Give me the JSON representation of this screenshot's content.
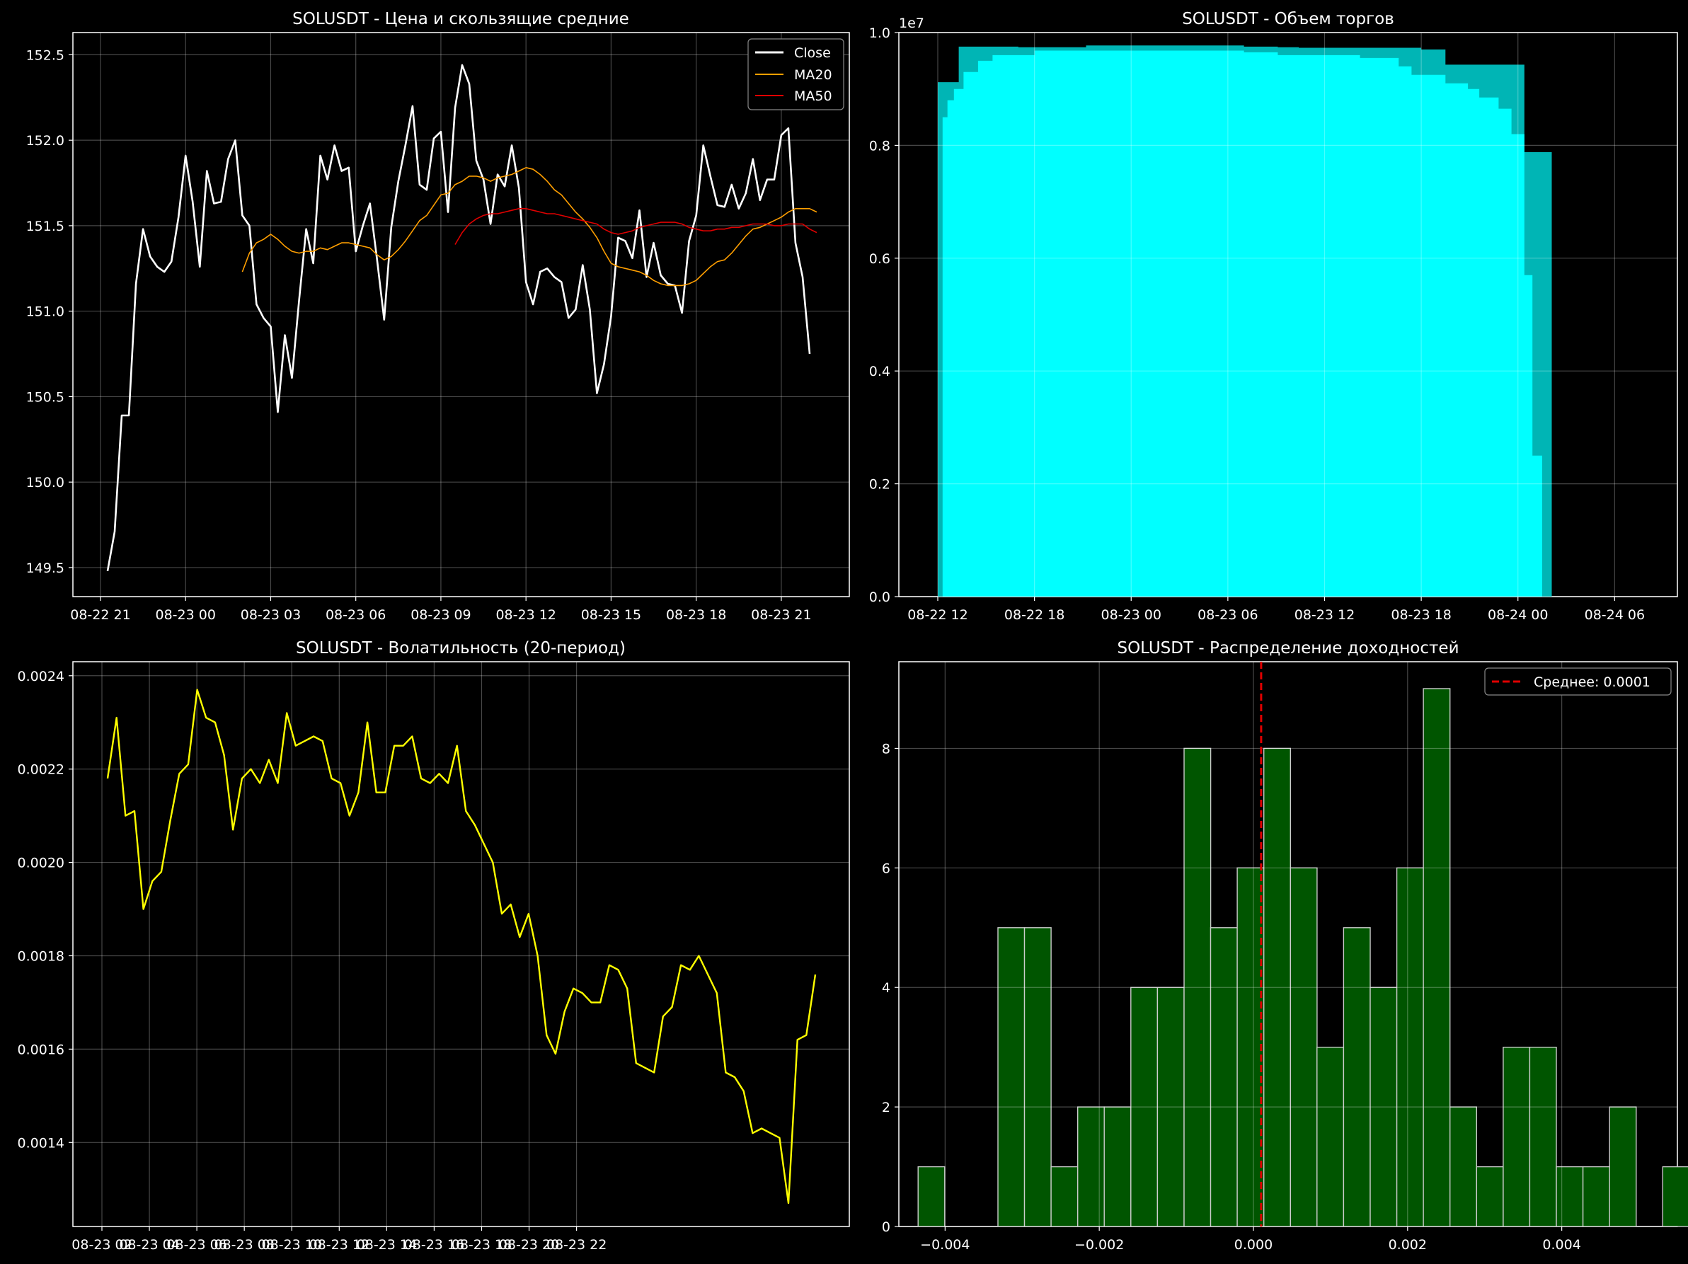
{
  "chart_data": [
    {
      "type": "line",
      "title": "SOLUSDT - Цена и скользящие средние",
      "x_tick_labels": [
        "08-22 21",
        "08-23 00",
        "08-23 03",
        "08-23 06",
        "08-23 09",
        "08-23 12",
        "08-23 15",
        "08-23 18",
        "08-23 21"
      ],
      "y_tick_labels": [
        "149.5",
        "150.0",
        "150.5",
        "151.0",
        "151.5",
        "152.0",
        "152.5"
      ],
      "ylim": [
        149.33,
        152.63
      ],
      "grid": true,
      "legend_position": "top-right",
      "series": [
        {
          "name": "Close",
          "color": "#ffffff",
          "start_index": 0,
          "values": [
            149.48,
            149.71,
            150.39,
            150.39,
            151.16,
            151.48,
            151.32,
            151.26,
            151.23,
            151.29,
            151.55,
            151.91,
            151.64,
            151.26,
            151.82,
            151.63,
            151.64,
            151.89,
            152.0,
            151.56,
            151.5,
            151.04,
            150.96,
            150.91,
            150.41,
            150.86,
            150.61,
            151.06,
            151.48,
            151.28,
            151.91,
            151.77,
            151.97,
            151.82,
            151.84,
            151.35,
            151.5,
            151.63,
            151.3,
            150.95,
            151.49,
            151.76,
            151.97,
            152.2,
            151.74,
            151.71,
            152.01,
            152.05,
            151.58,
            152.19,
            152.44,
            152.33,
            151.88,
            151.77,
            151.51,
            151.8,
            151.73,
            151.97,
            151.72,
            151.17,
            151.04,
            151.23,
            151.25,
            151.2,
            151.17,
            150.96,
            151.01,
            151.27,
            151.01,
            150.52,
            150.69,
            150.97,
            151.43,
            151.41,
            151.31,
            151.59,
            151.2,
            151.4,
            151.21,
            151.16,
            151.15,
            150.99,
            151.41,
            151.56,
            151.97,
            151.79,
            151.62,
            151.61,
            151.74,
            151.6,
            151.69,
            151.89,
            151.65,
            151.77,
            151.77,
            152.03,
            152.07,
            151.4,
            151.2,
            150.75
          ]
        },
        {
          "name": "MA20",
          "color": "#ff9f00",
          "start_index": 19,
          "values": [
            151.23,
            151.34,
            151.4,
            151.42,
            151.45,
            151.42,
            151.38,
            151.35,
            151.34,
            151.35,
            151.35,
            151.37,
            151.36,
            151.38,
            151.4,
            151.4,
            151.39,
            151.38,
            151.37,
            151.33,
            151.3,
            151.32,
            151.36,
            151.41,
            151.47,
            151.53,
            151.56,
            151.62,
            151.68,
            151.69,
            151.74,
            151.76,
            151.79,
            151.79,
            151.78,
            151.76,
            151.78,
            151.79,
            151.8,
            151.82,
            151.84,
            151.83,
            151.8,
            151.76,
            151.71,
            151.68,
            151.63,
            151.58,
            151.54,
            151.49,
            151.43,
            151.35,
            151.28,
            151.26,
            151.25,
            151.24,
            151.23,
            151.21,
            151.18,
            151.16,
            151.15,
            151.15,
            151.15,
            151.16,
            151.18,
            151.22,
            151.26,
            151.29,
            151.3,
            151.34,
            151.39,
            151.44,
            151.48,
            151.49,
            151.51,
            151.53,
            151.55,
            151.58,
            151.6,
            151.6,
            151.6,
            151.58
          ]
        },
        {
          "name": "MA50",
          "color": "#e00000",
          "start_index": 49,
          "values": [
            151.39,
            151.46,
            151.51,
            151.54,
            151.56,
            151.57,
            151.57,
            151.58,
            151.59,
            151.6,
            151.6,
            151.59,
            151.58,
            151.57,
            151.57,
            151.56,
            151.55,
            151.54,
            151.53,
            151.52,
            151.51,
            151.48,
            151.46,
            151.45,
            151.46,
            151.47,
            151.49,
            151.5,
            151.51,
            151.52,
            151.52,
            151.52,
            151.51,
            151.49,
            151.48,
            151.47,
            151.47,
            151.48,
            151.48,
            151.49,
            151.49,
            151.5,
            151.51,
            151.51,
            151.51,
            151.5,
            151.5,
            151.51,
            151.51,
            151.51,
            151.48,
            151.46
          ]
        }
      ]
    },
    {
      "type": "area",
      "title": "SOLUSDT - Объем торгов",
      "offset_label": "1e7",
      "x_tick_labels": [
        "08-22 12",
        "08-22 18",
        "08-23 00",
        "08-23 06",
        "08-23 12",
        "08-23 18",
        "08-24 00",
        "08-24 06"
      ],
      "y_tick_labels": [
        "0.0",
        "0.2",
        "0.4",
        "0.6",
        "0.8",
        "1.0"
      ],
      "ylim": [
        0,
        1.0
      ],
      "grid": true,
      "color": "#00ffff",
      "outer_envelope": [
        [
          0.0,
          0.912
        ],
        [
          1.3,
          0.975
        ],
        [
          5.0,
          0.974
        ],
        [
          9.2,
          0.977
        ],
        [
          19.0,
          0.975
        ],
        [
          21.1,
          0.974
        ],
        [
          22.4,
          0.973
        ],
        [
          30.0,
          0.97
        ],
        [
          31.5,
          0.943
        ],
        [
          34.8,
          0.943
        ],
        [
          36.4,
          0.788
        ],
        [
          37.4,
          0.788
        ],
        [
          38.1,
          0.136
        ]
      ],
      "inner_steps": [
        [
          0.1,
          0.0
        ],
        [
          0.3,
          0.85
        ],
        [
          0.6,
          0.88
        ],
        [
          1.0,
          0.9
        ],
        [
          1.6,
          0.93
        ],
        [
          2.5,
          0.95
        ],
        [
          3.4,
          0.96
        ],
        [
          6.0,
          0.968
        ],
        [
          19.0,
          0.965
        ],
        [
          21.1,
          0.96
        ],
        [
          26.2,
          0.955
        ],
        [
          28.6,
          0.94
        ],
        [
          29.4,
          0.925
        ],
        [
          31.5,
          0.91
        ],
        [
          32.9,
          0.9
        ],
        [
          33.6,
          0.885
        ],
        [
          34.8,
          0.865
        ],
        [
          35.6,
          0.82
        ],
        [
          36.4,
          0.57
        ],
        [
          36.9,
          0.25
        ],
        [
          37.5,
          0.0
        ]
      ]
    },
    {
      "type": "line",
      "title": "SOLUSDT - Волатильность (20-период)",
      "x_tick_labels": [
        "08-23 02",
        "08-23 04",
        "08-23 06",
        "08-23 08",
        "08-23 10",
        "08-23 12",
        "08-23 14",
        "08-23 16",
        "08-23 18",
        "08-23 20",
        "08-23 22"
      ],
      "y_tick_labels": [
        "0.0014",
        "0.0016",
        "0.0018",
        "0.0020",
        "0.0022",
        "0.0024"
      ],
      "ylim": [
        0.00122,
        0.00243
      ],
      "grid": true,
      "series": [
        {
          "name": "",
          "color": "#ffff00",
          "values": [
            0.00218,
            0.00231,
            0.0021,
            0.00211,
            0.0019,
            0.00196,
            0.00198,
            0.00209,
            0.00219,
            0.00221,
            0.00237,
            0.00231,
            0.0023,
            0.00223,
            0.00207,
            0.00218,
            0.0022,
            0.00217,
            0.00222,
            0.00217,
            0.00232,
            0.00225,
            0.00226,
            0.00227,
            0.00226,
            0.00218,
            0.00217,
            0.0021,
            0.00215,
            0.0023,
            0.00215,
            0.00215,
            0.00225,
            0.00225,
            0.00227,
            0.00218,
            0.00217,
            0.00219,
            0.00217,
            0.00225,
            0.00211,
            0.00208,
            0.00204,
            0.002,
            0.00189,
            0.00191,
            0.00184,
            0.00189,
            0.0018,
            0.00163,
            0.00159,
            0.00168,
            0.00173,
            0.00172,
            0.0017,
            0.0017,
            0.00178,
            0.00177,
            0.00173,
            0.00157,
            0.00156,
            0.00155,
            0.00167,
            0.00169,
            0.00178,
            0.00177,
            0.0018,
            0.00176,
            0.00172,
            0.00155,
            0.00154,
            0.00151,
            0.00142,
            0.00143,
            0.00142,
            0.00141,
            0.00127,
            0.00162,
            0.00163,
            0.00176
          ]
        }
      ]
    },
    {
      "type": "bar",
      "title": "SOLUSDT - Распределение доходностей",
      "x_tick_labels": [
        "−0.004",
        "−0.002",
        "0.000",
        "0.002",
        "0.004"
      ],
      "y_tick_labels": [
        "0",
        "2",
        "4",
        "6",
        "8"
      ],
      "xlim": [
        -0.0046,
        0.0055
      ],
      "ylim": [
        0,
        9.45
      ],
      "grid": true,
      "legend_position": "top-right",
      "bin_start": -0.00435,
      "bin_width": 0.000345,
      "counts": [
        1,
        0,
        0,
        5,
        5,
        1,
        2,
        2,
        4,
        4,
        8,
        5,
        6,
        8,
        6,
        3,
        5,
        4,
        6,
        9,
        2,
        1,
        3,
        3,
        1,
        1,
        2,
        0,
        1,
        1
      ],
      "bar_color": "#005500",
      "edge_color": "#cccccc",
      "mean": 0.0001,
      "mean_line_color": "#e00000",
      "mean_label": "Среднее: 0.0001"
    }
  ]
}
